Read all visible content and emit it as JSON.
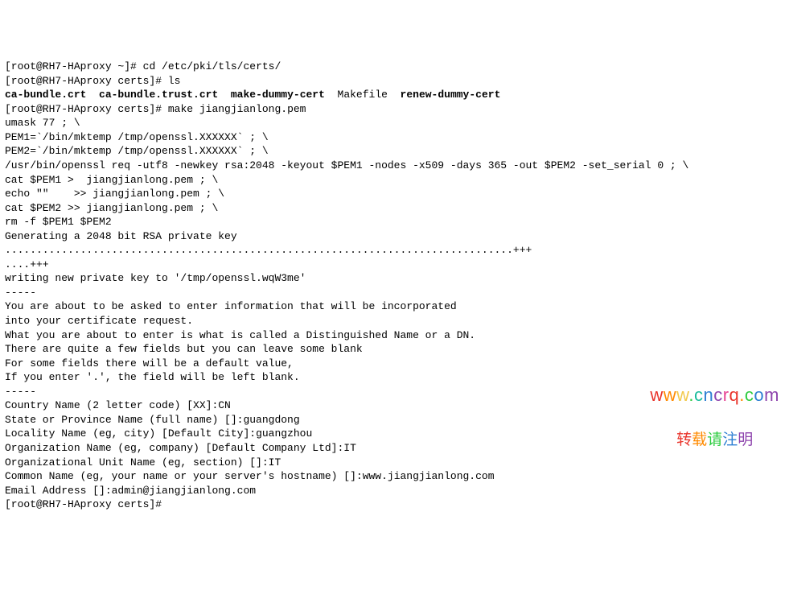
{
  "term": {
    "prompt1": "[root@RH7-HAproxy ~]# ",
    "cmd1": "cd /etc/pki/tls/certs/",
    "prompt2": "[root@RH7-HAproxy certs]# ",
    "cmd2": "ls",
    "ls_out": {
      "f1": "ca-bundle.crt",
      "f2": "ca-bundle.trust.crt",
      "f3": "make-dummy-cert",
      "f4": "Makefile",
      "f5": "renew-dummy-cert"
    },
    "prompt3": "[root@RH7-HAproxy certs]# ",
    "cmd3": "make jiangjianlong.pem",
    "make_out": [
      "umask 77 ; \\",
      "PEM1=`/bin/mktemp /tmp/openssl.XXXXXX` ; \\",
      "PEM2=`/bin/mktemp /tmp/openssl.XXXXXX` ; \\",
      "/usr/bin/openssl req -utf8 -newkey rsa:2048 -keyout $PEM1 -nodes -x509 -days 365 -out $PEM2 -set_serial 0 ; \\",
      "cat $PEM1 >  jiangjianlong.pem ; \\",
      "echo \"\"    >> jiangjianlong.pem ; \\",
      "cat $PEM2 >> jiangjianlong.pem ; \\",
      "rm -f $PEM1 $PEM2",
      "Generating a 2048 bit RSA private key",
      ".................................................................................+++",
      "....+++",
      "writing new private key to '/tmp/openssl.wqW3me'",
      "-----",
      "You are about to be asked to enter information that will be incorporated",
      "into your certificate request.",
      "What you are about to enter is what is called a Distinguished Name or a DN.",
      "There are quite a few fields but you can leave some blank",
      "For some fields there will be a default value,",
      "If you enter '.', the field will be left blank.",
      "-----"
    ],
    "qa": {
      "country_q": "Country Name (2 letter code) [XX]:",
      "country_a": "CN",
      "state_q": "State or Province Name (full name) []:",
      "state_a": "guangdong",
      "locality_q": "Locality Name (eg, city) [Default City]:",
      "locality_a": "guangzhou",
      "org_q": "Organization Name (eg, company) [Default Company Ltd]:",
      "org_a": "IT",
      "ou_q": "Organizational Unit Name (eg, section) []:",
      "ou_a": "IT",
      "cn_q": "Common Name (eg, your name or your server's hostname) []:",
      "cn_a": "www.jiangjianlong.com",
      "email_q": "Email Address []:",
      "email_a": "admin@jiangjianlong.com"
    },
    "prompt4": "[root@RH7-HAproxy certs]#"
  },
  "watermark": {
    "url_chars": [
      "w",
      "w",
      "w",
      ".",
      "c",
      "n",
      "c",
      "r",
      "q",
      ".",
      "c",
      "o",
      "m"
    ],
    "sub_chars": [
      "转",
      "载",
      "请",
      "注",
      "明"
    ]
  }
}
